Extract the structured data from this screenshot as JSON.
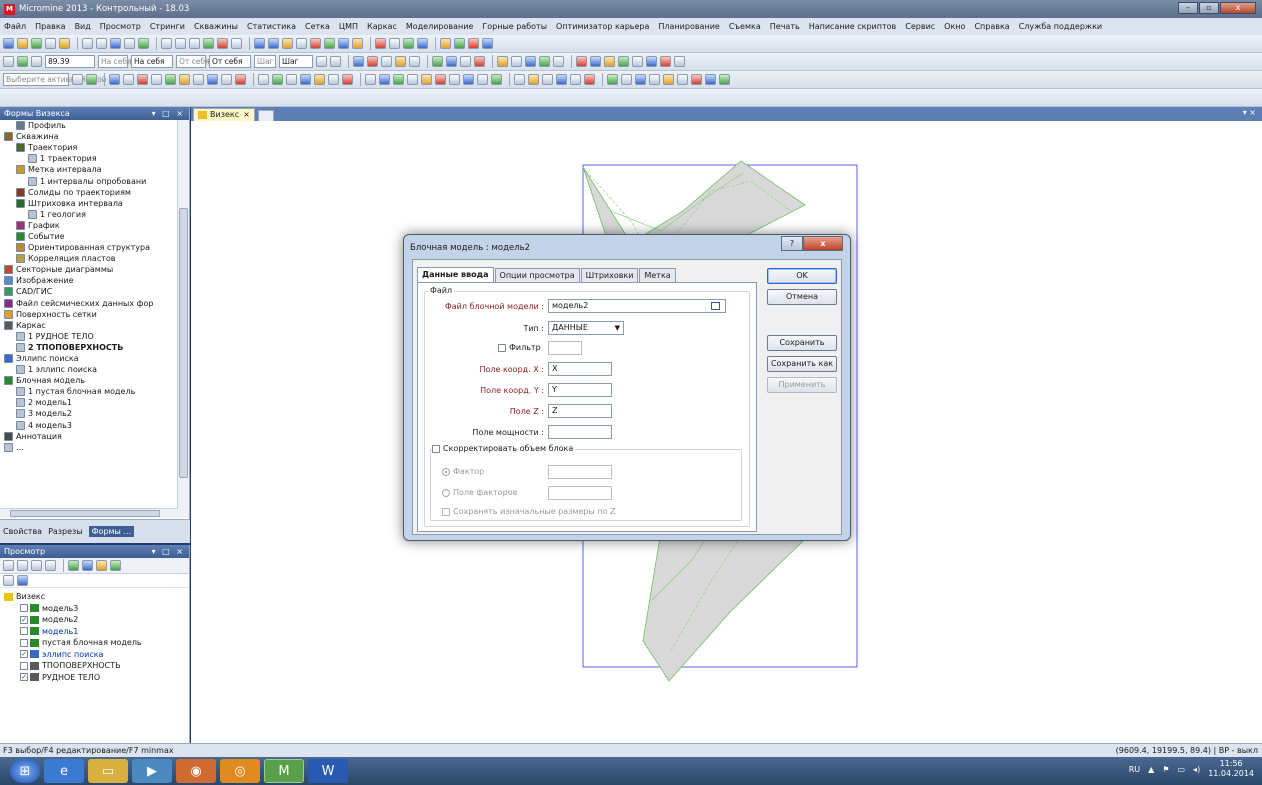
{
  "app": {
    "title": "Micromine 2013 - Контрольный - 18.03",
    "logo": "M"
  },
  "menu": [
    "Файл",
    "Правка",
    "Вид",
    "Просмотр",
    "Стринги",
    "Скважины",
    "Статистика",
    "Сетка",
    "ЦМП",
    "Каркас",
    "Моделирование",
    "Горные работы",
    "Оптимизатор карьера",
    "Планирование",
    "Съемка",
    "Печать",
    "Написание скриптов",
    "Сервис",
    "Окно",
    "Справка",
    "Служба поддержки"
  ],
  "toolbar2": {
    "value": "89.39",
    "field_a": "На себя",
    "field_b": "На себя",
    "field_c": "От себя",
    "field_d": "От себя",
    "field_e": "Шаг",
    "field_f": "Шаг"
  },
  "toolbar3": {
    "layer_placeholder": "Выберите активный слой"
  },
  "forms_pane": {
    "title": "Формы Визекса",
    "controls": "▾ □ ×",
    "tree": [
      {
        "label": "Профиль",
        "indent": 1,
        "color": "#6a7a8a"
      },
      {
        "label": "Скважина",
        "indent": 0,
        "color": "#8a6a2a"
      },
      {
        "label": "Траектория",
        "indent": 1,
        "color": "#4a6a2a"
      },
      {
        "label": "1 траектория",
        "indent": 2,
        "color": "#b8c4d4"
      },
      {
        "label": "Метка интервала",
        "indent": 1,
        "color": "#c89a2a"
      },
      {
        "label": "1 интервалы опробовани",
        "indent": 2,
        "color": "#b8c4d4"
      },
      {
        "label": "Солиды по траекториям",
        "indent": 1,
        "color": "#8a3a1a"
      },
      {
        "label": "Штриховка интервала",
        "indent": 1,
        "color": "#2a6a2a"
      },
      {
        "label": "1 геология",
        "indent": 2,
        "color": "#b8c4d4"
      },
      {
        "label": "График",
        "indent": 1,
        "color": "#a03070"
      },
      {
        "label": "Событие",
        "indent": 1,
        "color": "#2a8a2a"
      },
      {
        "label": "Ориентированная структура",
        "indent": 1,
        "color": "#c08a2a"
      },
      {
        "label": "Корреляция пластов",
        "indent": 1,
        "color": "#c0a040"
      },
      {
        "label": "Секторные диаграммы",
        "indent": 0,
        "color": "#d04030"
      },
      {
        "label": "Изображение",
        "indent": 0,
        "color": "#5a8ac8"
      },
      {
        "label": "CAD/ГИС",
        "indent": 0,
        "color": "#3a9a5a"
      },
      {
        "label": "Файл сейсмических данных фор",
        "indent": 0,
        "color": "#8a2a8a"
      },
      {
        "label": "Поверхность сетки",
        "indent": 0,
        "color": "#e0a020"
      },
      {
        "label": "Каркас",
        "indent": 0,
        "color": "#5a5a5a"
      },
      {
        "label": "1 РУДНОЕ ТЕЛО",
        "indent": 1,
        "color": "#b8c4d4"
      },
      {
        "label": "2 ТПОПОВЕРХНОСТЬ",
        "indent": 1,
        "color": "#b8c4d4",
        "bold": true
      },
      {
        "label": "Эллипс поиска",
        "indent": 0,
        "color": "#3a6ac8"
      },
      {
        "label": "1 эллипс поиска",
        "indent": 1,
        "color": "#b8c4d4"
      },
      {
        "label": "Блочная модель",
        "indent": 0,
        "color": "#2a8a2a"
      },
      {
        "label": "1 пустая блочная модель",
        "indent": 1,
        "color": "#b8c4d4"
      },
      {
        "label": "2 модель1",
        "indent": 1,
        "color": "#b8c4d4"
      },
      {
        "label": "3 модель2",
        "indent": 1,
        "color": "#b8c4d4"
      },
      {
        "label": "4 модель3",
        "indent": 1,
        "color": "#b8c4d4"
      },
      {
        "label": "Аннотация",
        "indent": 0,
        "color": "#4a4a4a"
      },
      {
        "label": "...",
        "indent": 0,
        "color": "#b8c4d4"
      }
    ],
    "bottom_tabs": [
      "Свойства",
      "Разрезы",
      "Формы ..."
    ]
  },
  "view_pane": {
    "title": "Просмотр",
    "controls": "▾ □ ×",
    "root": "Визекс",
    "layers": [
      {
        "label": "модель3",
        "checked": false,
        "blue": false
      },
      {
        "label": "модель2",
        "checked": true,
        "blue": false
      },
      {
        "label": "модель1",
        "checked": false,
        "blue": true
      },
      {
        "label": "пустая блочная модель",
        "checked": false,
        "blue": false
      },
      {
        "label": "эллипс поиска",
        "checked": true,
        "blue": true
      },
      {
        "label": "ТПОПОВЕРХНОСТЬ",
        "checked": false,
        "blue": false
      },
      {
        "label": "РУДНОЕ ТЕЛО",
        "checked": true,
        "blue": false
      }
    ]
  },
  "doc_tab": {
    "label": "Визекс",
    "close": "×",
    "right_controls": "▾ ×"
  },
  "dialog": {
    "title": "Блочная модель : модель2",
    "help": "?",
    "close": "x",
    "tabs": [
      "Данные ввода",
      "Опции просмотра",
      "Штриховки",
      "Метка"
    ],
    "group_file": "Файл",
    "fields": {
      "file_label": "Файл блочной модели :",
      "file_value": "модель2",
      "type_label": "Тип :",
      "type_value": "ДАННЫЕ",
      "filter_label": "Фильтр",
      "x_label": "Поле коорд. X :",
      "x_value": "X",
      "y_label": "Поле коорд. Y :",
      "y_value": "Y",
      "z_label": "Поле Z :",
      "z_value": "Z",
      "power_label": "Поле мощности :",
      "power_value": ""
    },
    "correct_group": "Скорректировать объем блока",
    "factor": "Фактор",
    "factor_field": "Поле факторов",
    "keep_sizes": "Сохранять изначальные размеры по Z",
    "buttons": {
      "ok": "OK",
      "cancel": "Отмена",
      "save": "Сохранить",
      "save_as": "Сохранить как",
      "apply": "Применить"
    }
  },
  "status": {
    "left": "F3 выбор/F4 редактирование/F7 minmax",
    "right": "(9609.4, 19199.5, 89.4) | ВР - выкл"
  },
  "taskbar": {
    "lang": "RU",
    "time": "11:56",
    "date": "11.04.2014"
  }
}
